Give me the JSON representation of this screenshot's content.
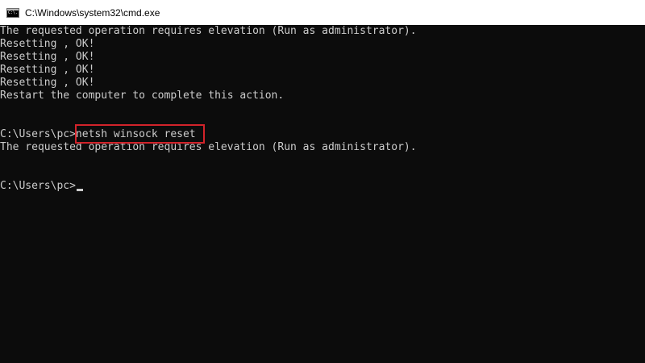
{
  "window": {
    "title": "C:\\Windows\\system32\\cmd.exe",
    "icon": "console-app-icon",
    "icon_glyph": "C:\\."
  },
  "console": {
    "lines": [
      "The requested operation requires elevation (Run as administrator).",
      "Resetting , OK!",
      "Resetting , OK!",
      "Resetting , OK!",
      "Resetting , OK!",
      "Restart the computer to complete this action.",
      "",
      "",
      "C:\\Users\\pc>netsh winsock reset",
      "The requested operation requires elevation (Run as administrator).",
      "",
      "",
      "C:\\Users\\pc>"
    ],
    "prompt": "C:\\Users\\pc>",
    "highlighted_command": "netsh winsock reset",
    "cursor": "_"
  },
  "colors": {
    "background": "#0c0c0c",
    "text": "#cccccc",
    "titlebar": "#ffffff",
    "highlight_border": "#d2232a"
  }
}
